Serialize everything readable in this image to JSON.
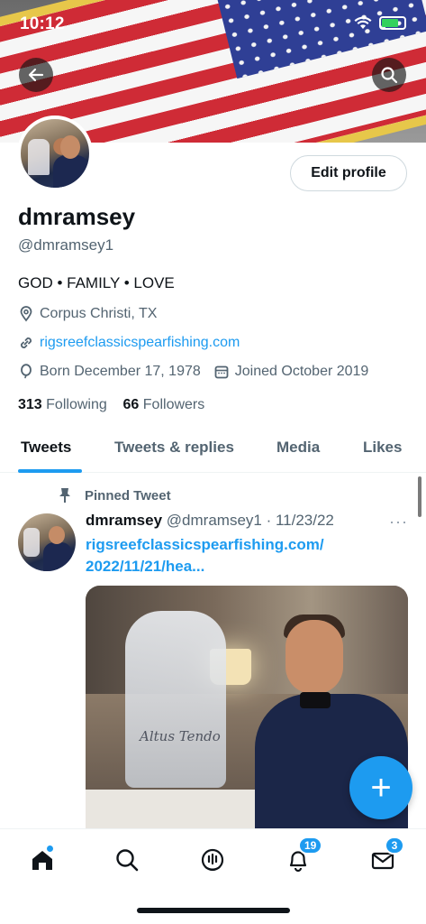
{
  "status_bar": {
    "time": "10:12"
  },
  "profile": {
    "display_name": "dmramsey",
    "handle": "@dmramsey1",
    "bio": "GOD • FAMILY • LOVE",
    "location": "Corpus Christi, TX",
    "website": "rigsreefclassicspearfishing.com",
    "born": "Born December 17, 1978",
    "joined": "Joined October 2019",
    "following_count": "313",
    "following_label": "Following",
    "followers_count": "66",
    "followers_label": "Followers",
    "edit_label": "Edit profile"
  },
  "tabs": [
    {
      "label": "Tweets",
      "active": true
    },
    {
      "label": "Tweets & replies"
    },
    {
      "label": "Media"
    },
    {
      "label": "Likes"
    }
  ],
  "tweet": {
    "pinned_label": "Pinned Tweet",
    "author_name": "dmramsey",
    "meta": "@dmramsey1 · 11/23/22",
    "more": "···",
    "text_line1": "rigsreefclassicspearfishing.com/",
    "text_line2": "2022/11/21/hea...",
    "image_caption": "Altus Tendo"
  },
  "fab_label": "+",
  "bottom_nav": {
    "notifications_badge": "19",
    "messages_badge": "3"
  },
  "colors": {
    "accent": "#1d9bf0",
    "text": "#0f1419",
    "muted": "#536471"
  },
  "icons": [
    "back-arrow-icon",
    "search-icon",
    "location-pin-icon",
    "link-icon",
    "balloon-icon",
    "calendar-icon",
    "pin-icon",
    "home-icon",
    "explore-icon",
    "spaces-icon",
    "bell-icon",
    "mail-icon"
  ]
}
